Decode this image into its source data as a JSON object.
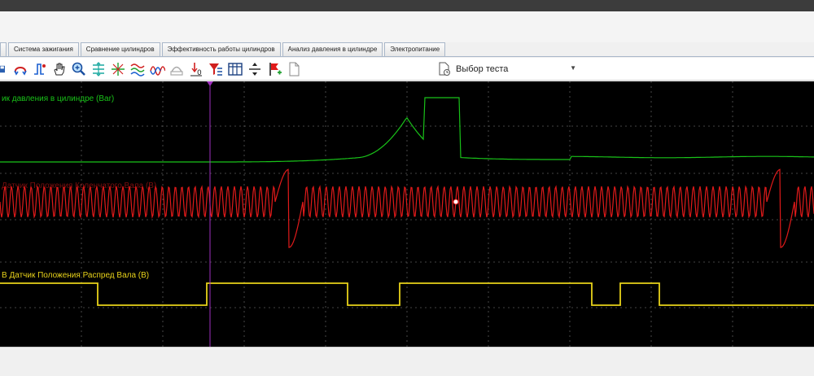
{
  "tabs": [
    {
      "label": "Система зажигания",
      "active": false
    },
    {
      "label": "Сравнение цилиндров",
      "active": false
    },
    {
      "label": "Эффективность работы цилиндров",
      "active": false
    },
    {
      "label": "Анализ давления в цилиндре",
      "active": false
    },
    {
      "label": "Электропитание",
      "active": false
    }
  ],
  "toolbar": {
    "test_select_label": "Выбор теста"
  },
  "channels": {
    "pressure": {
      "label": "ик давления в цилиндре (Bar)",
      "color": "#19c219"
    },
    "crank": {
      "label": "Датчик Положения Коленчатого Вала (В)",
      "color": "#e01a1a"
    },
    "cam": {
      "label": "В Датчик Положения Распред Вала (В)",
      "color": "#e8d21a"
    }
  },
  "colors": {
    "cursor": "#a030c0",
    "grid": "#5a5a5a"
  }
}
